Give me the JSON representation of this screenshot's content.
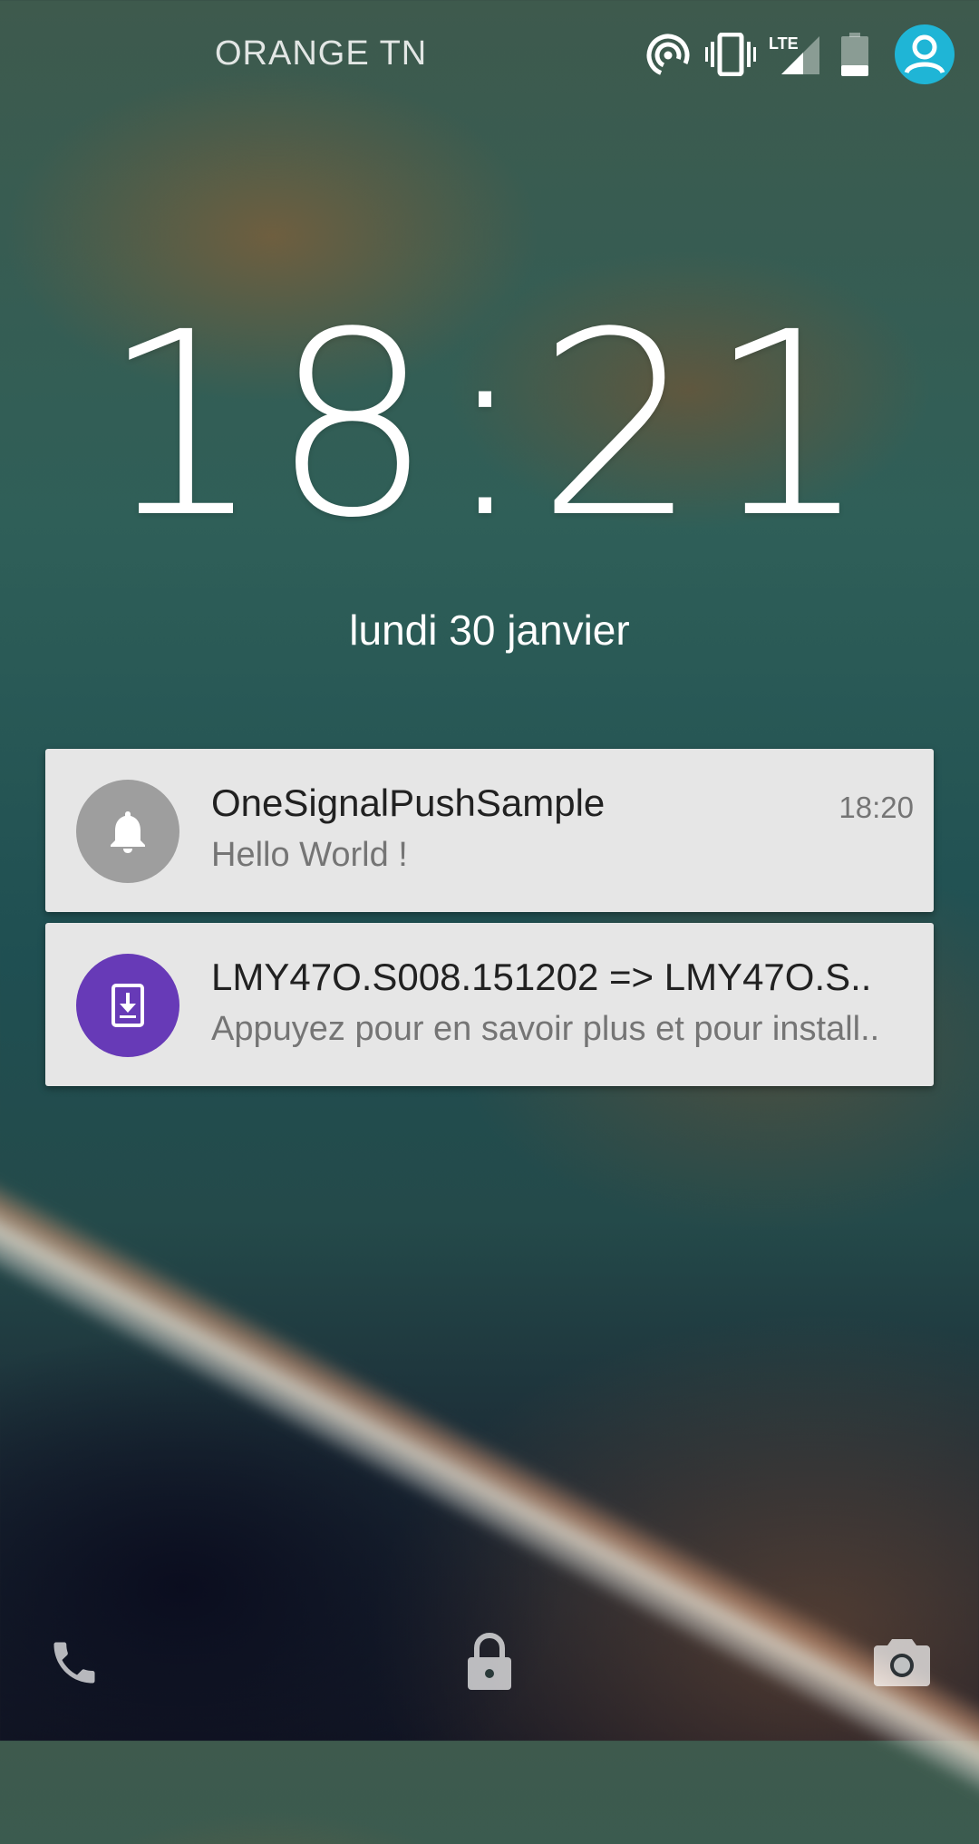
{
  "statusbar": {
    "carrier": "ORANGE TN",
    "network_label": "LTE",
    "icons": [
      "hotspot-icon",
      "vibrate-icon",
      "lte-signal-icon",
      "battery-icon",
      "user-avatar-icon"
    ],
    "avatar_color": "#1fb5d6"
  },
  "lockscreen": {
    "time": "18:21",
    "date": "lundi 30 janvier"
  },
  "notifications": [
    {
      "app_icon": "bell-icon",
      "icon_color": "#9e9e9e",
      "title": "OneSignalPushSample",
      "text": "Hello World !",
      "time": "18:20"
    },
    {
      "app_icon": "system-update-icon",
      "icon_color": "#673ab7",
      "title": "LMY47O.S008.151202 => LMY47O.S..",
      "text": "Appuyez pour en savoir plus et pour install.."
    }
  ],
  "bottom_actions": [
    "phone-icon",
    "lock-icon",
    "camera-icon"
  ]
}
